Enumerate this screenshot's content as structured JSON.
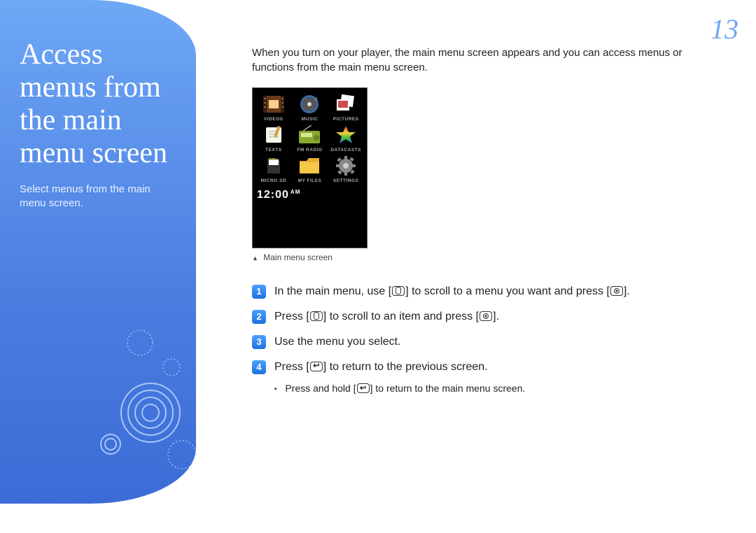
{
  "page_number": "13",
  "sidebar": {
    "title": "Access menus from the main menu screen",
    "subtitle": "Select menus from the main menu screen."
  },
  "content": {
    "intro": "When you turn on your player, the main menu screen appears and you can access menus or functions from the main menu screen.",
    "device_caption": "Main menu screen",
    "clock_time": "12:00",
    "clock_ampm": "AM",
    "menu_items": [
      {
        "label": "VIDEOS"
      },
      {
        "label": "MUSIC"
      },
      {
        "label": "PICTURES"
      },
      {
        "label": "TEXTS"
      },
      {
        "label": "FM RADIO"
      },
      {
        "label": "DATACASTS"
      },
      {
        "label": "MICRO SD"
      },
      {
        "label": "MY FILES"
      },
      {
        "label": "SETTINGS"
      }
    ],
    "steps": {
      "s1a": "In the main menu, use [",
      "s1b": "] to scroll to a menu you want and press [",
      "s1c": "].",
      "s2a": "Press [",
      "s2b": "] to scroll to an item and press [",
      "s2c": "].",
      "s3": "Use the menu you select.",
      "s4a": "Press [",
      "s4b": "] to return to the previous screen.",
      "sub_a": "Press and hold [",
      "sub_b": "] to return to the main menu screen."
    },
    "nums": {
      "n1": "1",
      "n2": "2",
      "n3": "3",
      "n4": "4"
    }
  }
}
